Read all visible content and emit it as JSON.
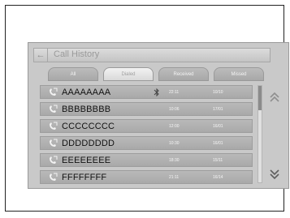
{
  "header": {
    "title": "Call History",
    "back_symbol": "←"
  },
  "tabs": [
    {
      "label": "All"
    },
    {
      "label": "Dialed"
    },
    {
      "label": "Received"
    },
    {
      "label": "Missed"
    }
  ],
  "calls": [
    {
      "name": "AAAAAAAA",
      "time": "22:11",
      "date": "10/10"
    },
    {
      "name": "BBBBBBBB",
      "time": "10:06",
      "date": "17/01"
    },
    {
      "name": "CCCCCCCC",
      "time": "12:00",
      "date": "16/01"
    },
    {
      "name": "DDDDDDDD",
      "time": "10:30",
      "date": "16/01"
    },
    {
      "name": "EEEEEEEE",
      "time": "18:30",
      "date": "15/11"
    },
    {
      "name": "FFFFFFFF",
      "time": "21:11",
      "date": "16/14"
    }
  ],
  "icons": {
    "back": "back-arrow-icon",
    "phone": "phone-outgoing-icon",
    "scroll_up": "chevron-double-up-icon",
    "scroll_down": "chevron-double-down-icon",
    "bluetooth": "bluetooth-icon"
  }
}
